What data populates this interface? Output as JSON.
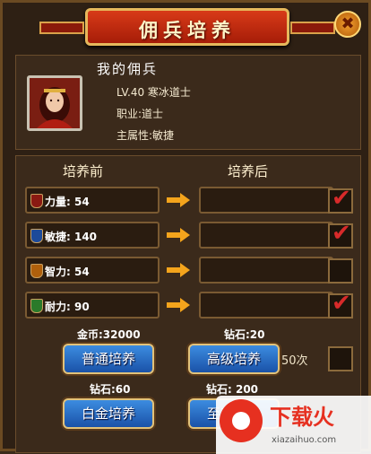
{
  "title": "佣兵培养",
  "hero": {
    "name": "我的佣兵",
    "level_line": "LV.40 寒冰道士",
    "job_line": "职业:道士",
    "attr_line": "主属性:敏捷"
  },
  "columns": {
    "before": "培养前",
    "after": "培养后"
  },
  "stats": [
    {
      "label": "力量: 54",
      "icon": "red-shield-icon",
      "checked": true
    },
    {
      "label": "敏捷: 140",
      "icon": "blue-shield-icon",
      "checked": true
    },
    {
      "label": "智力: 54",
      "icon": "orange-shield-icon",
      "checked": false
    },
    {
      "label": "耐力: 90",
      "icon": "green-shield-icon",
      "checked": true
    }
  ],
  "check_mark": "✔",
  "training": {
    "normal": {
      "cost": "金币:32000",
      "label": "普通培养"
    },
    "advanced": {
      "cost": "钻石:20",
      "label": "高级培养"
    },
    "platinum": {
      "cost": "钻石:60",
      "label": "白金培养"
    },
    "supreme": {
      "cost": "钻石: 200",
      "label": "至尊培养"
    },
    "count": "50次"
  },
  "close_symbol": "✖",
  "watermark": {
    "title": "下载火",
    "url": "xiazaihuo.com"
  },
  "colors": {
    "check": "#d82a2a",
    "button": "#2a6cc4",
    "banner": "#c22a10"
  }
}
